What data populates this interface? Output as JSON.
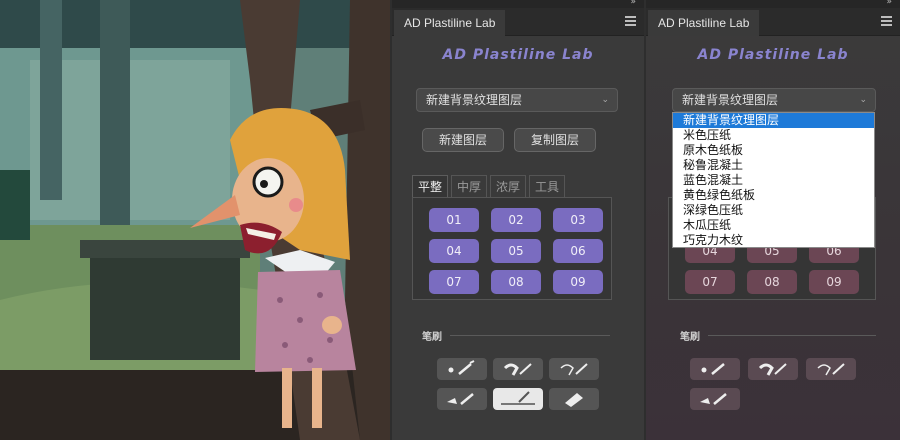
{
  "left_panel": {
    "tab_title": "AD Plastiline Lab",
    "plugin_title": "AD Plastiline Lab",
    "select_value": "新建背景纹理图层",
    "buttons": {
      "new_layer": "新建图层",
      "copy_layer": "复制图层"
    },
    "tabs": [
      "平整",
      "中厚",
      "浓厚",
      "工具"
    ],
    "active_tab": 0,
    "numbers": [
      "01",
      "02",
      "03",
      "04",
      "05",
      "06",
      "07",
      "08",
      "09"
    ],
    "brush_label": "笔刷"
  },
  "right_panel": {
    "tab_title": "AD Plastiline Lab",
    "plugin_title": "AD Plastiline Lab",
    "select_value": "新建背景纹理图层",
    "dropdown_options": [
      "新建背景纹理图层",
      "米色压纸",
      "原木色纸板",
      "秘鲁混凝土",
      "蓝色混凝土",
      "黄色绿色纸板",
      "深绿色压纸",
      "木瓜压纸",
      "巧克力木纹"
    ],
    "dropdown_highlighted": 0,
    "numbers_visible": [
      "04",
      "05",
      "06",
      "07",
      "08",
      "09"
    ],
    "brush_label": "笔刷"
  },
  "topstrip_controls": "»",
  "icons": [
    "hamburger-menu-icon",
    "chevron-down-icon",
    "brush-icon",
    "pen-icon",
    "eraser-icon",
    "smudge-icon"
  ],
  "colors": {
    "accent_purple": "#7a6cc0",
    "title_purple": "#8a84cf",
    "right_num_btn": "#6b4654",
    "dropdown_highlight": "#1e7ad8"
  }
}
